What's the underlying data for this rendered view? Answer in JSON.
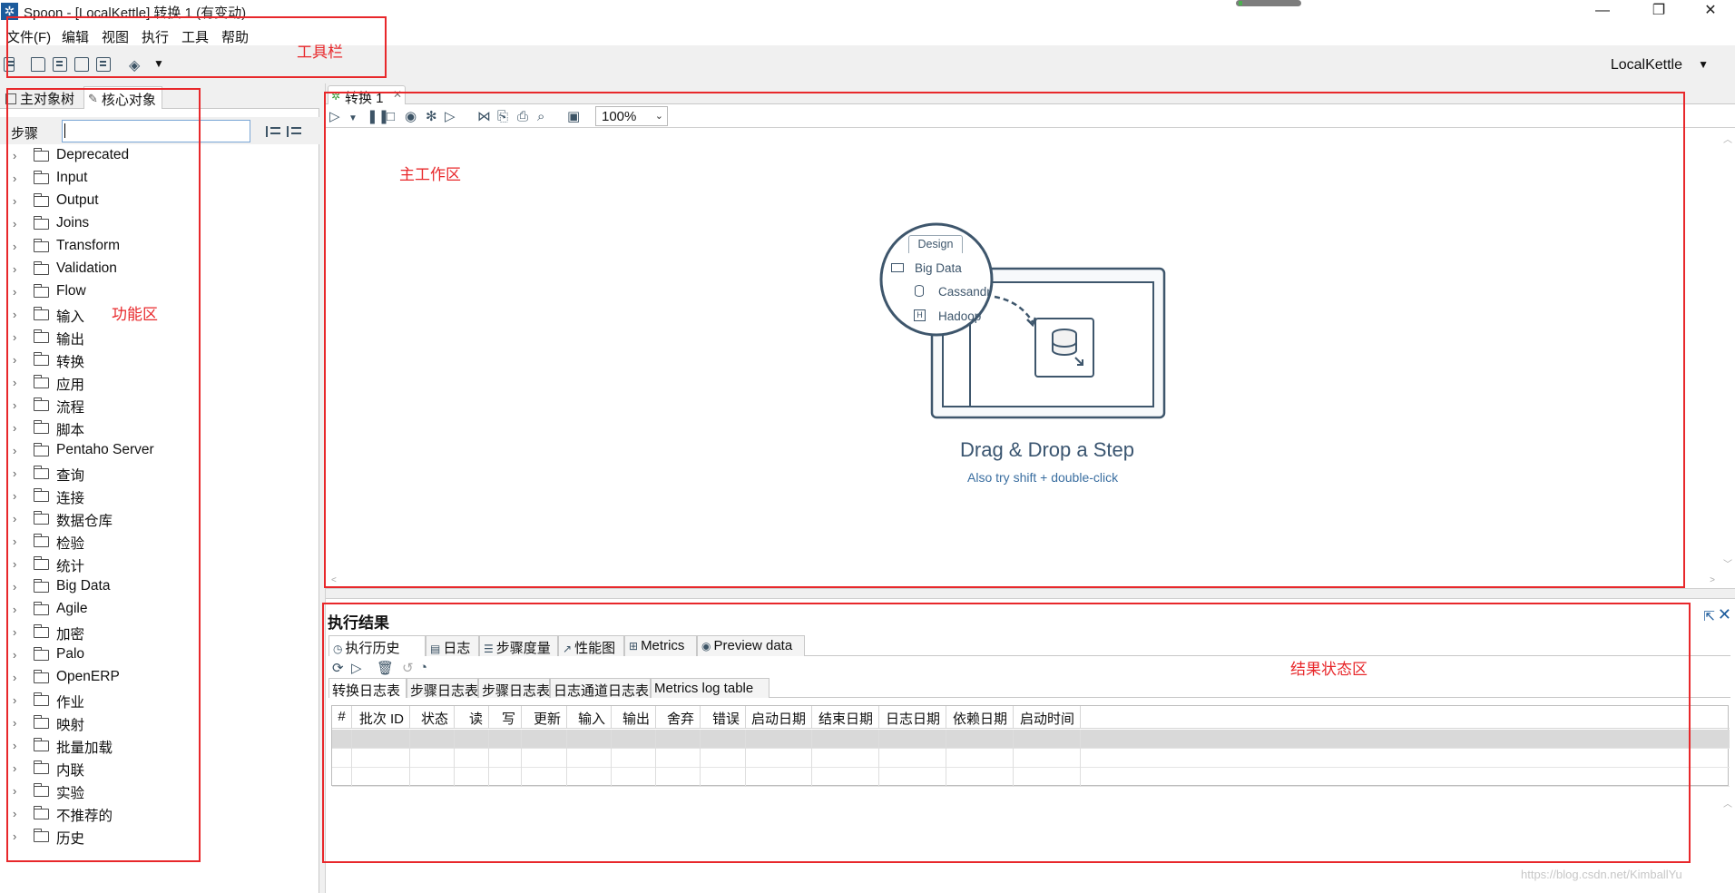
{
  "window": {
    "title": "Spoon - [LocalKettle] 转换 1 (有变动)",
    "minimize": "—",
    "restore": "❐",
    "close": "✕"
  },
  "menubar": {
    "items": [
      "文件(F)",
      "编辑",
      "视图",
      "执行",
      "工具",
      "帮助"
    ]
  },
  "toolbar": {
    "repository": "LocalKettle",
    "icons": [
      "new-file-icon",
      "open-file-icon",
      "explore-repository-icon",
      "save-icon",
      "save-as-icon",
      "layers-icon"
    ]
  },
  "left_panel": {
    "tabs": [
      "主对象树",
      "核心对象"
    ],
    "search_label": "步骤",
    "search_value": "",
    "tree_items": [
      "Deprecated",
      "Input",
      "Output",
      "Joins",
      "Transform",
      "Validation",
      "Flow",
      "输入",
      "输出",
      "转换",
      "应用",
      "流程",
      "脚本",
      "Pentaho Server",
      "查询",
      "连接",
      "数据仓库",
      "检验",
      "统计",
      "Big Data",
      "Agile",
      "加密",
      "Palo",
      "OpenERP",
      "作业",
      "映射",
      "批量加载",
      "内联",
      "实验",
      "不推荐的",
      "历史"
    ]
  },
  "editor": {
    "tab_label": "转换 1",
    "zoom": "100%",
    "illustration": {
      "tab": "Design",
      "folder": "Big Data",
      "item1": "Cassandr",
      "item2": "Hadoop"
    },
    "drag_title": "Drag & Drop a Step",
    "drag_subtitle": "Also try shift + double-click"
  },
  "results": {
    "title": "执行结果",
    "tabs": [
      "执行历史",
      "日志",
      "步骤度量",
      "性能图",
      "Metrics",
      "Preview data"
    ],
    "log_tabs": [
      "转换日志表",
      "步骤日志表",
      "步骤日志表",
      "日志通道日志表",
      "Metrics log table"
    ],
    "columns": [
      "#",
      "批次 ID",
      "状态",
      "读",
      "写",
      "更新",
      "输入",
      "输出",
      "舍弃",
      "错误",
      "启动日期",
      "结束日期",
      "日志日期",
      "依赖日期",
      "启动时间"
    ]
  },
  "annotations": {
    "toolbar": "工具栏",
    "function_area": "功能区",
    "main_work_area": "主工作区",
    "result_area": "结果状态区"
  },
  "watermark": "https://blog.csdn.net/KimballYu"
}
